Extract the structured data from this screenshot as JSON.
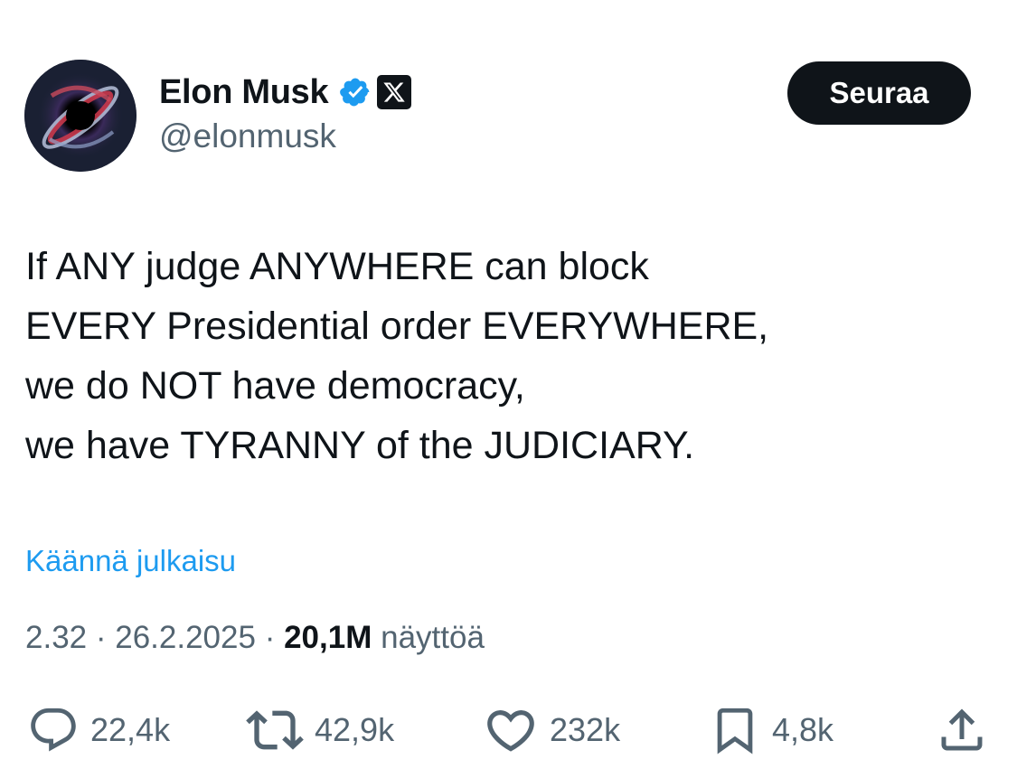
{
  "author": {
    "name": "Elon Musk",
    "handle": "@elonmusk",
    "avatar_icon": "black-hole-avatar",
    "verified_icon": "verified-badge-icon",
    "affiliation_icon": "x-logo-icon"
  },
  "follow_button": {
    "label": "Seuraa"
  },
  "tweet": {
    "lines": [
      "If ANY judge ANYWHERE can block",
      "EVERY Presidential order EVERYWHERE,",
      "we do NOT have democracy,",
      "we have TYRANNY of the JUDICIARY."
    ]
  },
  "translate_link": "Käännä julkaisu",
  "meta": {
    "time": "2.32",
    "separator": "·",
    "date": "26.2.2025",
    "views_count": "20,1M",
    "views_label": "näyttöä"
  },
  "actions": {
    "replies": "22,4k",
    "reposts": "42,9k",
    "likes": "232k",
    "bookmarks": "4,8k"
  },
  "colors": {
    "text": "#0f1419",
    "secondary": "#536471",
    "link": "#1d9bf0",
    "verified": "#1d9bf0",
    "button_bg": "#0f1419"
  }
}
